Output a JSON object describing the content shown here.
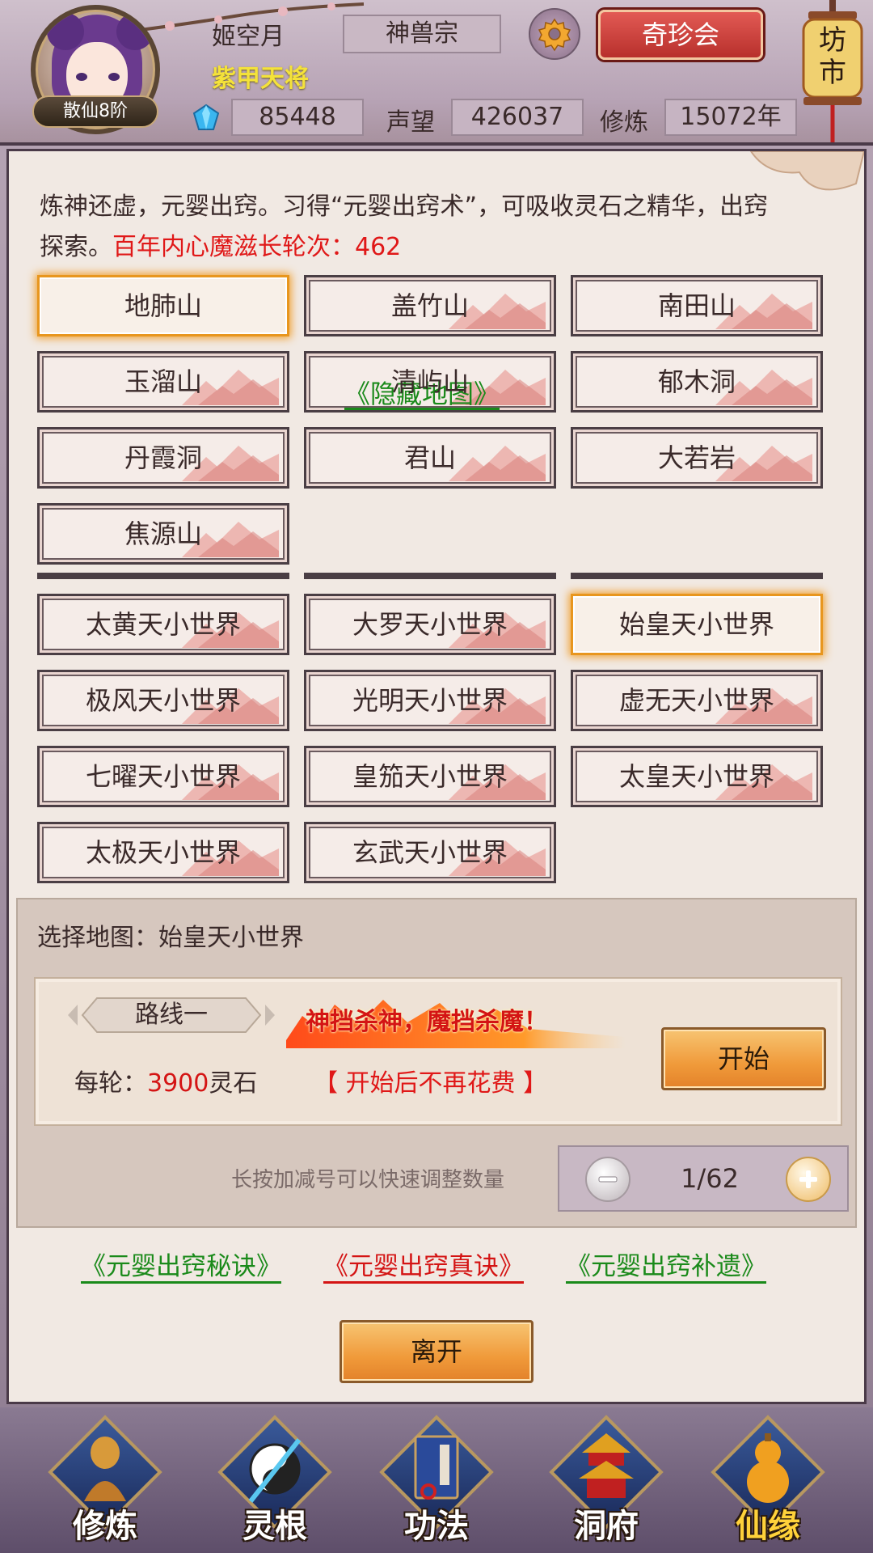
{
  "header": {
    "player_name": "姬空月",
    "player_title": "紫甲天将",
    "rank": "散仙8阶",
    "sect": "神兽宗",
    "treasure_button": "奇珍会",
    "market_button": "坊市",
    "spirit_stones": "85448",
    "reputation_label": "声望",
    "reputation": "426037",
    "cultivation_label": "修炼",
    "cultivation": "15072年"
  },
  "intro": {
    "text": "炼神还虚，元婴出窍。习得“元婴出窍术”，可吸收灵石之精华，出窍探索。",
    "highlight": "百年内心魔滋长轮次：462"
  },
  "maps": {
    "row1": [
      "地肺山",
      "盖竹山",
      "南田山"
    ],
    "row2": [
      "玉溜山",
      "清屿山",
      "郁木洞"
    ],
    "row3": [
      "丹霞洞",
      "君山",
      "大若岩"
    ],
    "row4": [
      "焦源山"
    ],
    "hidden_link": "《隐藏地图》",
    "worlds_row1": [
      "太黄天小世界",
      "大罗天小世界",
      "始皇天小世界"
    ],
    "worlds_row2": [
      "极风天小世界",
      "光明天小世界",
      "虚无天小世界"
    ],
    "worlds_row3": [
      "七曜天小世界",
      "皇笳天小世界",
      "太皇天小世界"
    ],
    "worlds_row4": [
      "太极天小世界",
      "玄武天小世界"
    ]
  },
  "selection": {
    "title": "选择地图：始皇天小世界",
    "route": "路线一",
    "slogan": "神挡杀神，魔挡杀魔！",
    "cost_label": "每轮：",
    "cost_value": "3900",
    "cost_unit": "灵石",
    "no_more_cost": "【 开始后不再花费 】",
    "start_button": "开始",
    "hint": "长按加减号可以快速调整数量",
    "quantity": "1/62"
  },
  "guides": {
    "secret": "《元婴出窍秘诀》",
    "true": "《元婴出窍真诀》",
    "supplement": "《元婴出窍补遗》"
  },
  "leave_button": "离开",
  "nav": {
    "items": [
      "修炼",
      "灵根",
      "功法",
      "洞府",
      "仙缘"
    ]
  },
  "colors": {
    "accent_red": "#e01818",
    "link_green": "#1a8a1a",
    "link_red": "#d41414",
    "selected_border": "#e8961e",
    "title_yellow": "#f4e23a"
  }
}
